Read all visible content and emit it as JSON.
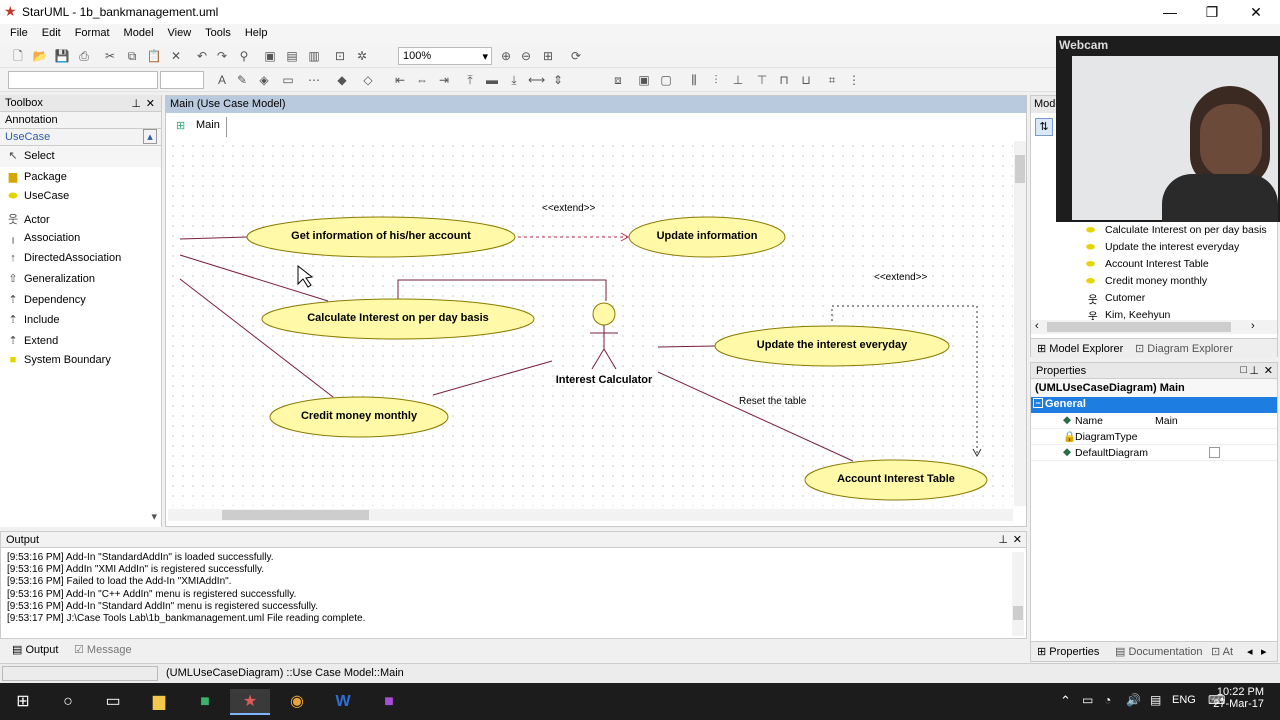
{
  "window": {
    "title": "StarUML - 1b_bankmanagement.uml"
  },
  "menu": [
    "File",
    "Edit",
    "Format",
    "Model",
    "View",
    "Tools",
    "Help"
  ],
  "toolbar": {
    "zoom": "100%"
  },
  "toolbox": {
    "title": "Toolbox",
    "sections": [
      "Annotation",
      "UseCase"
    ],
    "items": [
      "Select",
      "Package",
      "UseCase",
      "Actor",
      "Association",
      "DirectedAssociation",
      "Generalization",
      "Dependency",
      "Include",
      "Extend",
      "System Boundary"
    ]
  },
  "diagram": {
    "panel_title": "Main (Use Case Model)",
    "tab": "Main",
    "actor": "Interest Calculator",
    "usecases": {
      "get_info": "Get information of his/her account",
      "update_info": "Update information",
      "calc_interest": "Calculate Interest on per day basis",
      "update_interest": "Update the interest everyday",
      "credit_money": "Credit money monthly",
      "account_table": "Account Interest Table"
    },
    "labels": {
      "extend1": "<<extend>>",
      "extend2": "<<extend>>",
      "reset": "Reset the table"
    }
  },
  "webcam": {
    "label": "Webcam"
  },
  "model_explorer": {
    "header": "Mode",
    "items": [
      "Calculate Interest on per day basis",
      "Update the interest everyday",
      "Account Interest Table",
      "Credit money monthly",
      "Cutomer",
      "Kim, Keehyun"
    ],
    "tabs": [
      "Model Explorer",
      "Diagram Explorer"
    ]
  },
  "properties": {
    "title": "Properties",
    "object": "(UMLUseCaseDiagram) Main",
    "group": "General",
    "rows": [
      {
        "name": "Name",
        "value": "Main"
      },
      {
        "name": "DiagramType",
        "value": ""
      },
      {
        "name": "DefaultDiagram",
        "value": ""
      }
    ],
    "tabs": [
      "Properties",
      "Documentation",
      "At"
    ]
  },
  "output": {
    "title": "Output",
    "lines": [
      "[9:53:16 PM]  Add-In \"StandardAddIn\" is loaded successfully.",
      "[9:53:16 PM]  AddIn \"XMI AddIn\" is registered successfully.",
      "[9:53:16 PM]  Failed to load the Add-In \"XMIAddIn\".",
      "[9:53:16 PM]  Add-In \"C++ AddIn\" menu is registered successfully.",
      "[9:53:16 PM]  Add-In \"Standard AddIn\" menu is registered successfully.",
      "[9:53:17 PM]  J:\\Case Tools Lab\\1b_bankmanagement.uml File reading complete."
    ],
    "tabs": [
      "Output",
      "Message"
    ]
  },
  "status": {
    "text": "(UMLUseCaseDiagram) ::Use Case Model::Main"
  },
  "taskbar": {
    "lang": "ENG",
    "time": "10:22 PM",
    "date": "27-Mar-17"
  }
}
